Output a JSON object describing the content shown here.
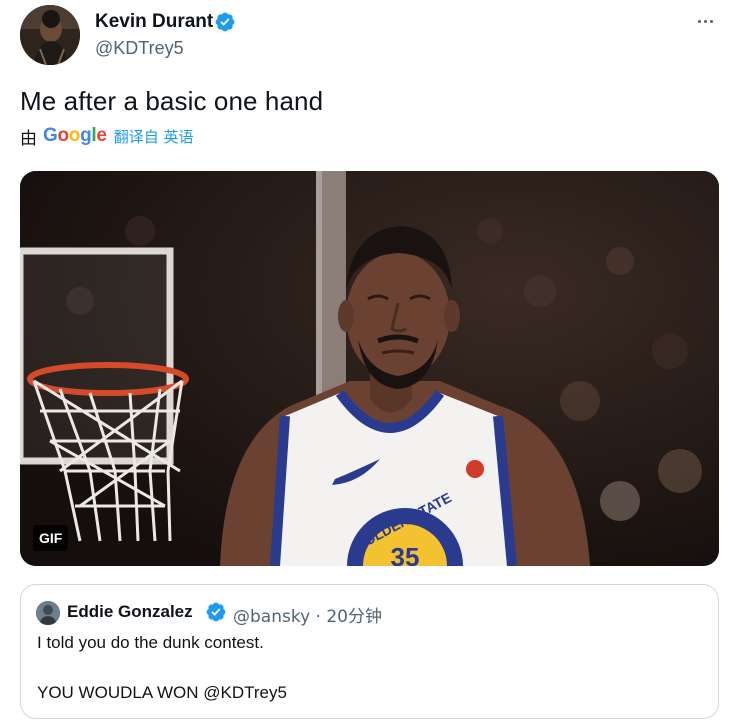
{
  "author": {
    "name": "Kevin Durant",
    "handle": "@KDTrey5",
    "verified": true
  },
  "tweet": {
    "text": "Me after a basic one hand"
  },
  "translation": {
    "prefix": "由",
    "provider_letters": [
      "G",
      "o",
      "o",
      "g",
      "l",
      "e"
    ],
    "link_text": "翻译自 英语"
  },
  "media": {
    "badge": "GIF",
    "jersey_text": "GOLDEN STATE",
    "jersey_number": "35"
  },
  "quoted_tweet": {
    "author_name": "Eddie Gonzalez",
    "verified": true,
    "meta": "@bansky · 20分钟",
    "line1": "I told you do the dunk contest.",
    "line2": "YOU WOUDLA WON @KDTrey5"
  },
  "icons": [
    "verified-badge-icon",
    "more-options-icon"
  ],
  "colors": {
    "accent": "#1d9bf0",
    "secondary_text": "#536471",
    "primary_text": "#0f1419",
    "border": "#cfd9de"
  }
}
